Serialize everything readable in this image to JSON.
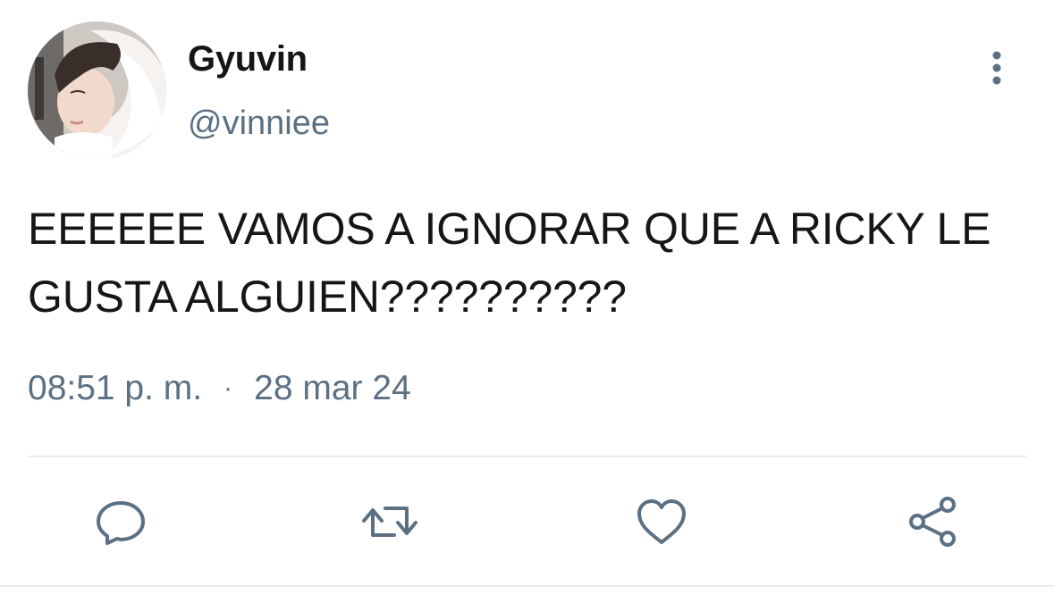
{
  "user": {
    "display_name": "Gyuvin",
    "handle": "@vinniee",
    "avatar_icon": "profile-photo"
  },
  "tweet": {
    "text": "EEEEEE VAMOS A IGNORAR QUE A RICKY LE GUSTA ALGUIEN??????????",
    "time": "08:51 p. m.",
    "separator": "·",
    "date": "28 mar 24"
  },
  "actions": {
    "reply_icon": "reply-icon",
    "retweet_icon": "retweet-icon",
    "like_icon": "heart-icon",
    "share_icon": "share-icon",
    "more_icon": "more-vertical-icon"
  },
  "colors": {
    "text": "#14171a",
    "secondary": "#5b7083",
    "divider": "#e6ecf0"
  }
}
